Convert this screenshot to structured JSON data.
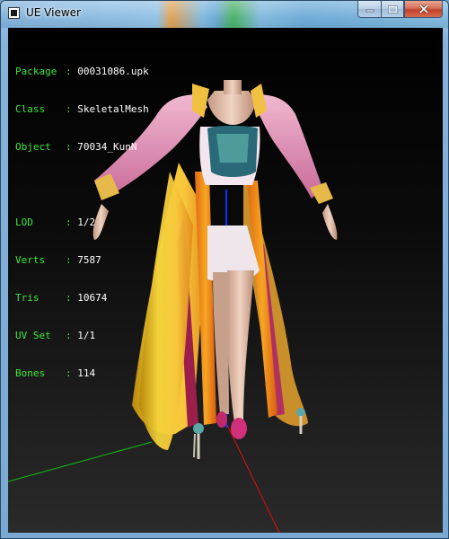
{
  "window": {
    "title": "UE Viewer",
    "caption_icons": [
      "minimize-icon",
      "maximize-icon",
      "close-icon"
    ]
  },
  "info": {
    "package": {
      "key": "Package",
      "value": "00031086.upk"
    },
    "class": {
      "key": "Class",
      "value": "SkeletalMesh"
    },
    "object": {
      "key": "Object",
      "value": "70034_KunN"
    },
    "lod": {
      "key": "LOD",
      "value": "1/2"
    },
    "verts": {
      "key": "Verts",
      "value": "7587"
    },
    "tris": {
      "key": "Tris",
      "value": "10674"
    },
    "uvset": {
      "key": "UV Set",
      "value": "1/1"
    },
    "bones": {
      "key": "Bones",
      "value": "114"
    }
  },
  "colors": {
    "info_key": "#3ee83e",
    "info_value": "#ffffff",
    "axis_x": "#e01010",
    "axis_y": "#10c010",
    "axis_z": "#1030ff"
  },
  "scene": {
    "model_description_icon": "skeletal-mesh-figure",
    "axes": [
      "x-axis",
      "y-axis",
      "z-axis"
    ]
  }
}
